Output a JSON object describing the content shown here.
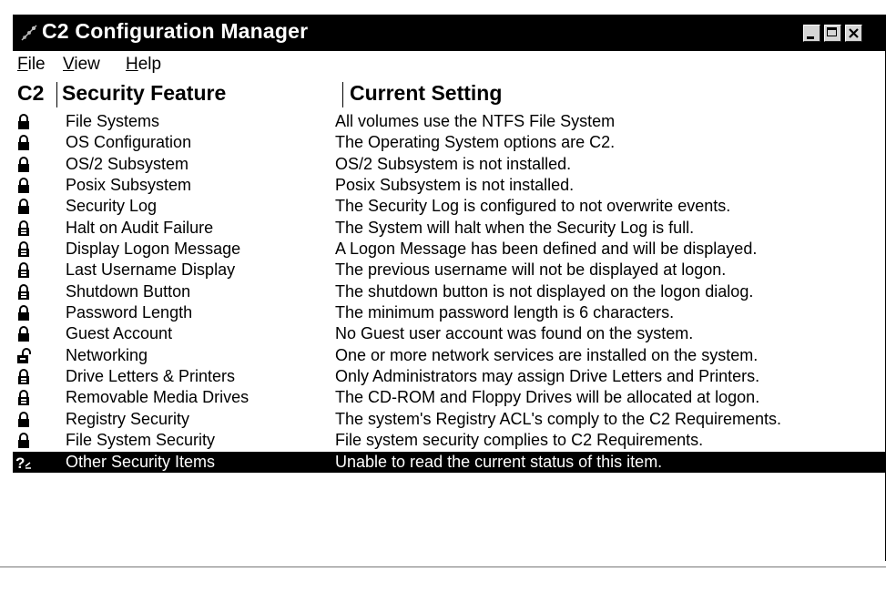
{
  "window": {
    "title": "C2 Configuration Manager"
  },
  "menu": {
    "file": {
      "accel": "F",
      "rest": "ile"
    },
    "view": {
      "accel": "V",
      "rest": "iew"
    },
    "help": {
      "accel": "H",
      "rest": "elp"
    }
  },
  "columns": {
    "c2": "C2",
    "feature": "Security Feature",
    "setting": "Current Setting"
  },
  "rows": [
    {
      "icon": "lock-closed-icon",
      "feature": "File Systems",
      "setting": "All volumes use the NTFS File System",
      "selected": false
    },
    {
      "icon": "lock-closed-icon",
      "feature": "OS Configuration",
      "setting": "The Operating System options are C2.",
      "selected": false
    },
    {
      "icon": "lock-closed-icon",
      "feature": "OS/2 Subsystem",
      "setting": "OS/2 Subsystem is not installed.",
      "selected": false
    },
    {
      "icon": "lock-closed-icon",
      "feature": "Posix Subsystem",
      "setting": "Posix Subsystem is not installed.",
      "selected": false
    },
    {
      "icon": "lock-closed-icon",
      "feature": "Security Log",
      "setting": "The Security Log is configured to not overwrite events.",
      "selected": false
    },
    {
      "icon": "lock-outline-icon",
      "feature": "Halt on Audit Failure",
      "setting": "The System will halt when the Security Log is full.",
      "selected": false
    },
    {
      "icon": "lock-outline-icon",
      "feature": "Display Logon Message",
      "setting": "A Logon Message has been defined and will be displayed.",
      "selected": false
    },
    {
      "icon": "lock-outline-icon",
      "feature": "Last Username Display",
      "setting": "The previous username will not be displayed at logon.",
      "selected": false
    },
    {
      "icon": "lock-outline-icon",
      "feature": "Shutdown Button",
      "setting": "The shutdown button is not displayed on the logon dialog.",
      "selected": false
    },
    {
      "icon": "lock-closed-icon",
      "feature": "Password Length",
      "setting": "The minimum password length is 6 characters.",
      "selected": false
    },
    {
      "icon": "lock-closed-icon",
      "feature": "Guest Account",
      "setting": "No Guest user account was found on the system.",
      "selected": false
    },
    {
      "icon": "lock-open-icon",
      "feature": "Networking",
      "setting": "One or more network services are installed on the system.",
      "selected": false
    },
    {
      "icon": "lock-outline-icon",
      "feature": "Drive Letters & Printers",
      "setting": "Only Administrators may assign Drive Letters and Printers.",
      "selected": false
    },
    {
      "icon": "lock-outline-icon",
      "feature": "Removable Media Drives",
      "setting": "The CD-ROM and Floppy Drives will be allocated at logon.",
      "selected": false
    },
    {
      "icon": "lock-closed-icon",
      "feature": "Registry Security",
      "setting": "The system's Registry ACL's comply to the C2 Requirements.",
      "selected": false
    },
    {
      "icon": "lock-closed-icon",
      "feature": "File System Security",
      "setting": "File system security complies to C2 Requirements.",
      "selected": false
    },
    {
      "icon": "question-mark-icon",
      "feature": "Other Security Items",
      "setting": "Unable to read the current status of this item.",
      "selected": true
    }
  ],
  "colors": {
    "titlebar": "#000000",
    "selection": "#000000",
    "background": "#ffffff"
  }
}
